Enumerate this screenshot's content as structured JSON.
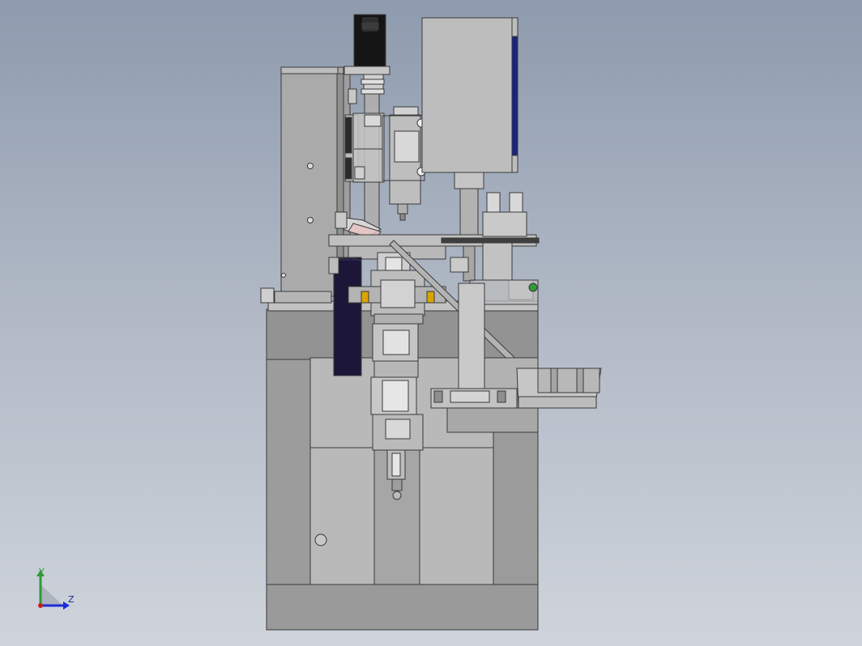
{
  "viewport": {
    "background_top": "#8e9bae",
    "background_bottom": "#cfd4dc"
  },
  "model": {
    "body_color": "#9a9a9a",
    "panel_color": "#b5b5b5",
    "motor_color": "#1a1a1a",
    "belt_color": "#1c1638",
    "accent_blue": "#1a237e",
    "accent_green": "#2e9a3a",
    "accent_orange": "#d9a400"
  },
  "triad": {
    "y_label": "Y",
    "z_label": "Z",
    "y_color": "#2e9a3a",
    "z_color": "#1d2bd8",
    "x_color": "#c81e1e"
  }
}
